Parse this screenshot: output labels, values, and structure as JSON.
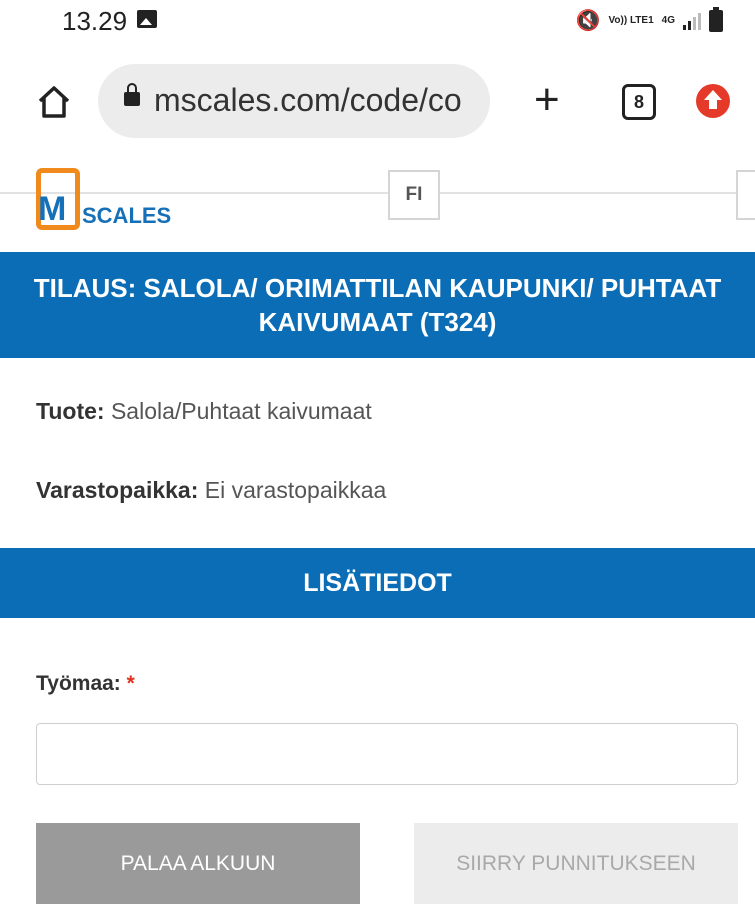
{
  "status_bar": {
    "time": "13.29",
    "volte_label": "Vo)) LTE1",
    "network_label": "4G"
  },
  "browser": {
    "url": "mscales.com/code/co",
    "tabs_count": "8",
    "icons": [
      "home-icon",
      "lock-icon",
      "plus-icon",
      "tabs-icon",
      "update-icon"
    ]
  },
  "header": {
    "logo_letter": "M",
    "logo_text": "SCALES",
    "language": "FI"
  },
  "order": {
    "title_line1": "TILAUS: SALOLA/ ORIMATTILAN KAUPUNKI/ PUHTAAT",
    "title_line2": "KAIVUMAAT (T324)"
  },
  "info": {
    "product_label": "Tuote:",
    "product_value": "Salola/Puhtaat kaivumaat",
    "storage_label": "Varastopaikka:",
    "storage_value": "Ei varastopaikkaa"
  },
  "details": {
    "section_title": "LISÄTIEDOT",
    "site_label": "Työmaa:",
    "required_mark": "*",
    "site_value": ""
  },
  "actions": {
    "back_label": "PALAA ALKUUN",
    "weigh_label": "SIIRRY PUNNITUKSEEN"
  },
  "colors": {
    "brand_blue": "#0a6db5",
    "logo_orange": "#f08a1c",
    "required_red": "#e0301e",
    "update_red": "#e53a2a"
  }
}
